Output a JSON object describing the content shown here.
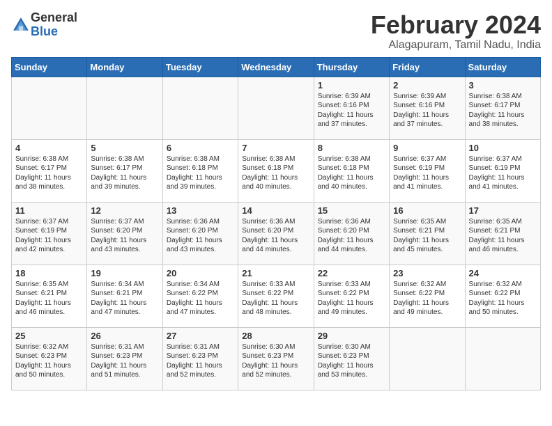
{
  "header": {
    "logo_general": "General",
    "logo_blue": "Blue",
    "title": "February 2024",
    "subtitle": "Alagapuram, Tamil Nadu, India"
  },
  "columns": [
    "Sunday",
    "Monday",
    "Tuesday",
    "Wednesday",
    "Thursday",
    "Friday",
    "Saturday"
  ],
  "weeks": [
    [
      {
        "day": "",
        "info": ""
      },
      {
        "day": "",
        "info": ""
      },
      {
        "day": "",
        "info": ""
      },
      {
        "day": "",
        "info": ""
      },
      {
        "day": "1",
        "info": "Sunrise: 6:39 AM\nSunset: 6:16 PM\nDaylight: 11 hours and 37 minutes."
      },
      {
        "day": "2",
        "info": "Sunrise: 6:39 AM\nSunset: 6:16 PM\nDaylight: 11 hours and 37 minutes."
      },
      {
        "day": "3",
        "info": "Sunrise: 6:38 AM\nSunset: 6:17 PM\nDaylight: 11 hours and 38 minutes."
      }
    ],
    [
      {
        "day": "4",
        "info": "Sunrise: 6:38 AM\nSunset: 6:17 PM\nDaylight: 11 hours and 38 minutes."
      },
      {
        "day": "5",
        "info": "Sunrise: 6:38 AM\nSunset: 6:17 PM\nDaylight: 11 hours and 39 minutes."
      },
      {
        "day": "6",
        "info": "Sunrise: 6:38 AM\nSunset: 6:18 PM\nDaylight: 11 hours and 39 minutes."
      },
      {
        "day": "7",
        "info": "Sunrise: 6:38 AM\nSunset: 6:18 PM\nDaylight: 11 hours and 40 minutes."
      },
      {
        "day": "8",
        "info": "Sunrise: 6:38 AM\nSunset: 6:18 PM\nDaylight: 11 hours and 40 minutes."
      },
      {
        "day": "9",
        "info": "Sunrise: 6:37 AM\nSunset: 6:19 PM\nDaylight: 11 hours and 41 minutes."
      },
      {
        "day": "10",
        "info": "Sunrise: 6:37 AM\nSunset: 6:19 PM\nDaylight: 11 hours and 41 minutes."
      }
    ],
    [
      {
        "day": "11",
        "info": "Sunrise: 6:37 AM\nSunset: 6:19 PM\nDaylight: 11 hours and 42 minutes."
      },
      {
        "day": "12",
        "info": "Sunrise: 6:37 AM\nSunset: 6:20 PM\nDaylight: 11 hours and 43 minutes."
      },
      {
        "day": "13",
        "info": "Sunrise: 6:36 AM\nSunset: 6:20 PM\nDaylight: 11 hours and 43 minutes."
      },
      {
        "day": "14",
        "info": "Sunrise: 6:36 AM\nSunset: 6:20 PM\nDaylight: 11 hours and 44 minutes."
      },
      {
        "day": "15",
        "info": "Sunrise: 6:36 AM\nSunset: 6:20 PM\nDaylight: 11 hours and 44 minutes."
      },
      {
        "day": "16",
        "info": "Sunrise: 6:35 AM\nSunset: 6:21 PM\nDaylight: 11 hours and 45 minutes."
      },
      {
        "day": "17",
        "info": "Sunrise: 6:35 AM\nSunset: 6:21 PM\nDaylight: 11 hours and 46 minutes."
      }
    ],
    [
      {
        "day": "18",
        "info": "Sunrise: 6:35 AM\nSunset: 6:21 PM\nDaylight: 11 hours and 46 minutes."
      },
      {
        "day": "19",
        "info": "Sunrise: 6:34 AM\nSunset: 6:21 PM\nDaylight: 11 hours and 47 minutes."
      },
      {
        "day": "20",
        "info": "Sunrise: 6:34 AM\nSunset: 6:22 PM\nDaylight: 11 hours and 47 minutes."
      },
      {
        "day": "21",
        "info": "Sunrise: 6:33 AM\nSunset: 6:22 PM\nDaylight: 11 hours and 48 minutes."
      },
      {
        "day": "22",
        "info": "Sunrise: 6:33 AM\nSunset: 6:22 PM\nDaylight: 11 hours and 49 minutes."
      },
      {
        "day": "23",
        "info": "Sunrise: 6:32 AM\nSunset: 6:22 PM\nDaylight: 11 hours and 49 minutes."
      },
      {
        "day": "24",
        "info": "Sunrise: 6:32 AM\nSunset: 6:22 PM\nDaylight: 11 hours and 50 minutes."
      }
    ],
    [
      {
        "day": "25",
        "info": "Sunrise: 6:32 AM\nSunset: 6:23 PM\nDaylight: 11 hours and 50 minutes."
      },
      {
        "day": "26",
        "info": "Sunrise: 6:31 AM\nSunset: 6:23 PM\nDaylight: 11 hours and 51 minutes."
      },
      {
        "day": "27",
        "info": "Sunrise: 6:31 AM\nSunset: 6:23 PM\nDaylight: 11 hours and 52 minutes."
      },
      {
        "day": "28",
        "info": "Sunrise: 6:30 AM\nSunset: 6:23 PM\nDaylight: 11 hours and 52 minutes."
      },
      {
        "day": "29",
        "info": "Sunrise: 6:30 AM\nSunset: 6:23 PM\nDaylight: 11 hours and 53 minutes."
      },
      {
        "day": "",
        "info": ""
      },
      {
        "day": "",
        "info": ""
      }
    ]
  ]
}
